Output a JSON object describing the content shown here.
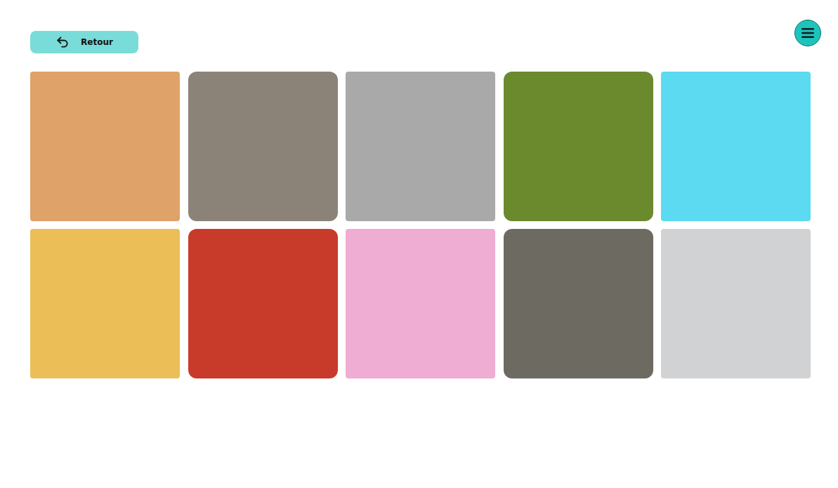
{
  "back_button": {
    "label": "Retour"
  },
  "tiles": [
    {
      "kind": "cutout",
      "color": "#d9924f"
    },
    {
      "kind": "photo",
      "color": "#8c8378"
    },
    {
      "kind": "cutout",
      "color": "#9a9a9a"
    },
    {
      "kind": "photo",
      "color": "#6b8a2e"
    },
    {
      "kind": "cutout",
      "color": "#3fd3ee"
    },
    {
      "kind": "cutout",
      "color": "#e8b33a"
    },
    {
      "kind": "photo",
      "color": "#c83a2a"
    },
    {
      "kind": "cutout",
      "color": "#ec9fcb"
    },
    {
      "kind": "photo",
      "color": "#6d6a62"
    },
    {
      "kind": "cutout",
      "color": "#c9cacb"
    }
  ]
}
